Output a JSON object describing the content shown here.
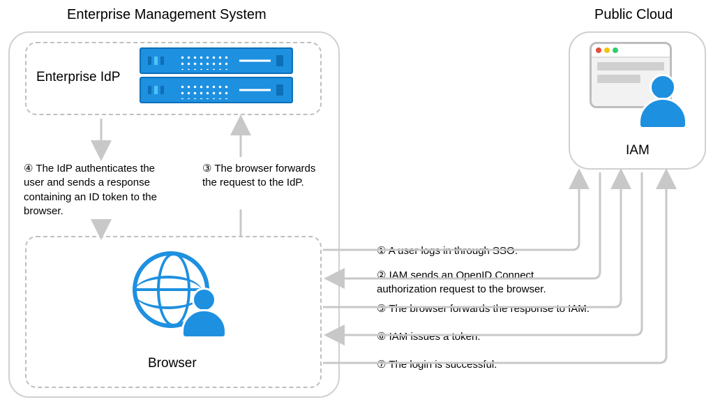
{
  "titles": {
    "enterprise": "Enterprise Management System",
    "publicCloud": "Public Cloud",
    "idp": "Enterprise IdP",
    "browser": "Browser",
    "iam": "IAM"
  },
  "steps": {
    "s1": "① A user logs in through SSO.",
    "s2": "② IAM sends an OpenID Connect authorization request to the browser.",
    "s3": "③ The browser forwards the request to the IdP.",
    "s4": "④ The IdP authenticates the user and sends a response containing an ID token to the browser.",
    "s5": "⑤ The browser forwards the response to IAM.",
    "s6": "⑥ IAM issues a token.",
    "s7": "⑦ The login is successful."
  },
  "chart_data": {
    "type": "flow",
    "nodes": [
      {
        "id": "idp",
        "label": "Enterprise IdP",
        "group": "Enterprise Management System"
      },
      {
        "id": "browser",
        "label": "Browser",
        "group": "Enterprise Management System"
      },
      {
        "id": "iam",
        "label": "IAM",
        "group": "Public Cloud"
      }
    ],
    "edges": [
      {
        "step": 1,
        "from": "browser",
        "to": "iam",
        "label": "A user logs in through SSO."
      },
      {
        "step": 2,
        "from": "iam",
        "to": "browser",
        "label": "IAM sends an OpenID Connect authorization request to the browser."
      },
      {
        "step": 3,
        "from": "browser",
        "to": "idp",
        "label": "The browser forwards the request to the IdP."
      },
      {
        "step": 4,
        "from": "idp",
        "to": "browser",
        "label": "The IdP authenticates the user and sends a response containing an ID token to the browser."
      },
      {
        "step": 5,
        "from": "browser",
        "to": "iam",
        "label": "The browser forwards the response to IAM."
      },
      {
        "step": 6,
        "from": "iam",
        "to": "browser",
        "label": "IAM issues a token."
      },
      {
        "step": 7,
        "from": "browser",
        "to": "iam",
        "label": "The login is successful."
      }
    ]
  }
}
